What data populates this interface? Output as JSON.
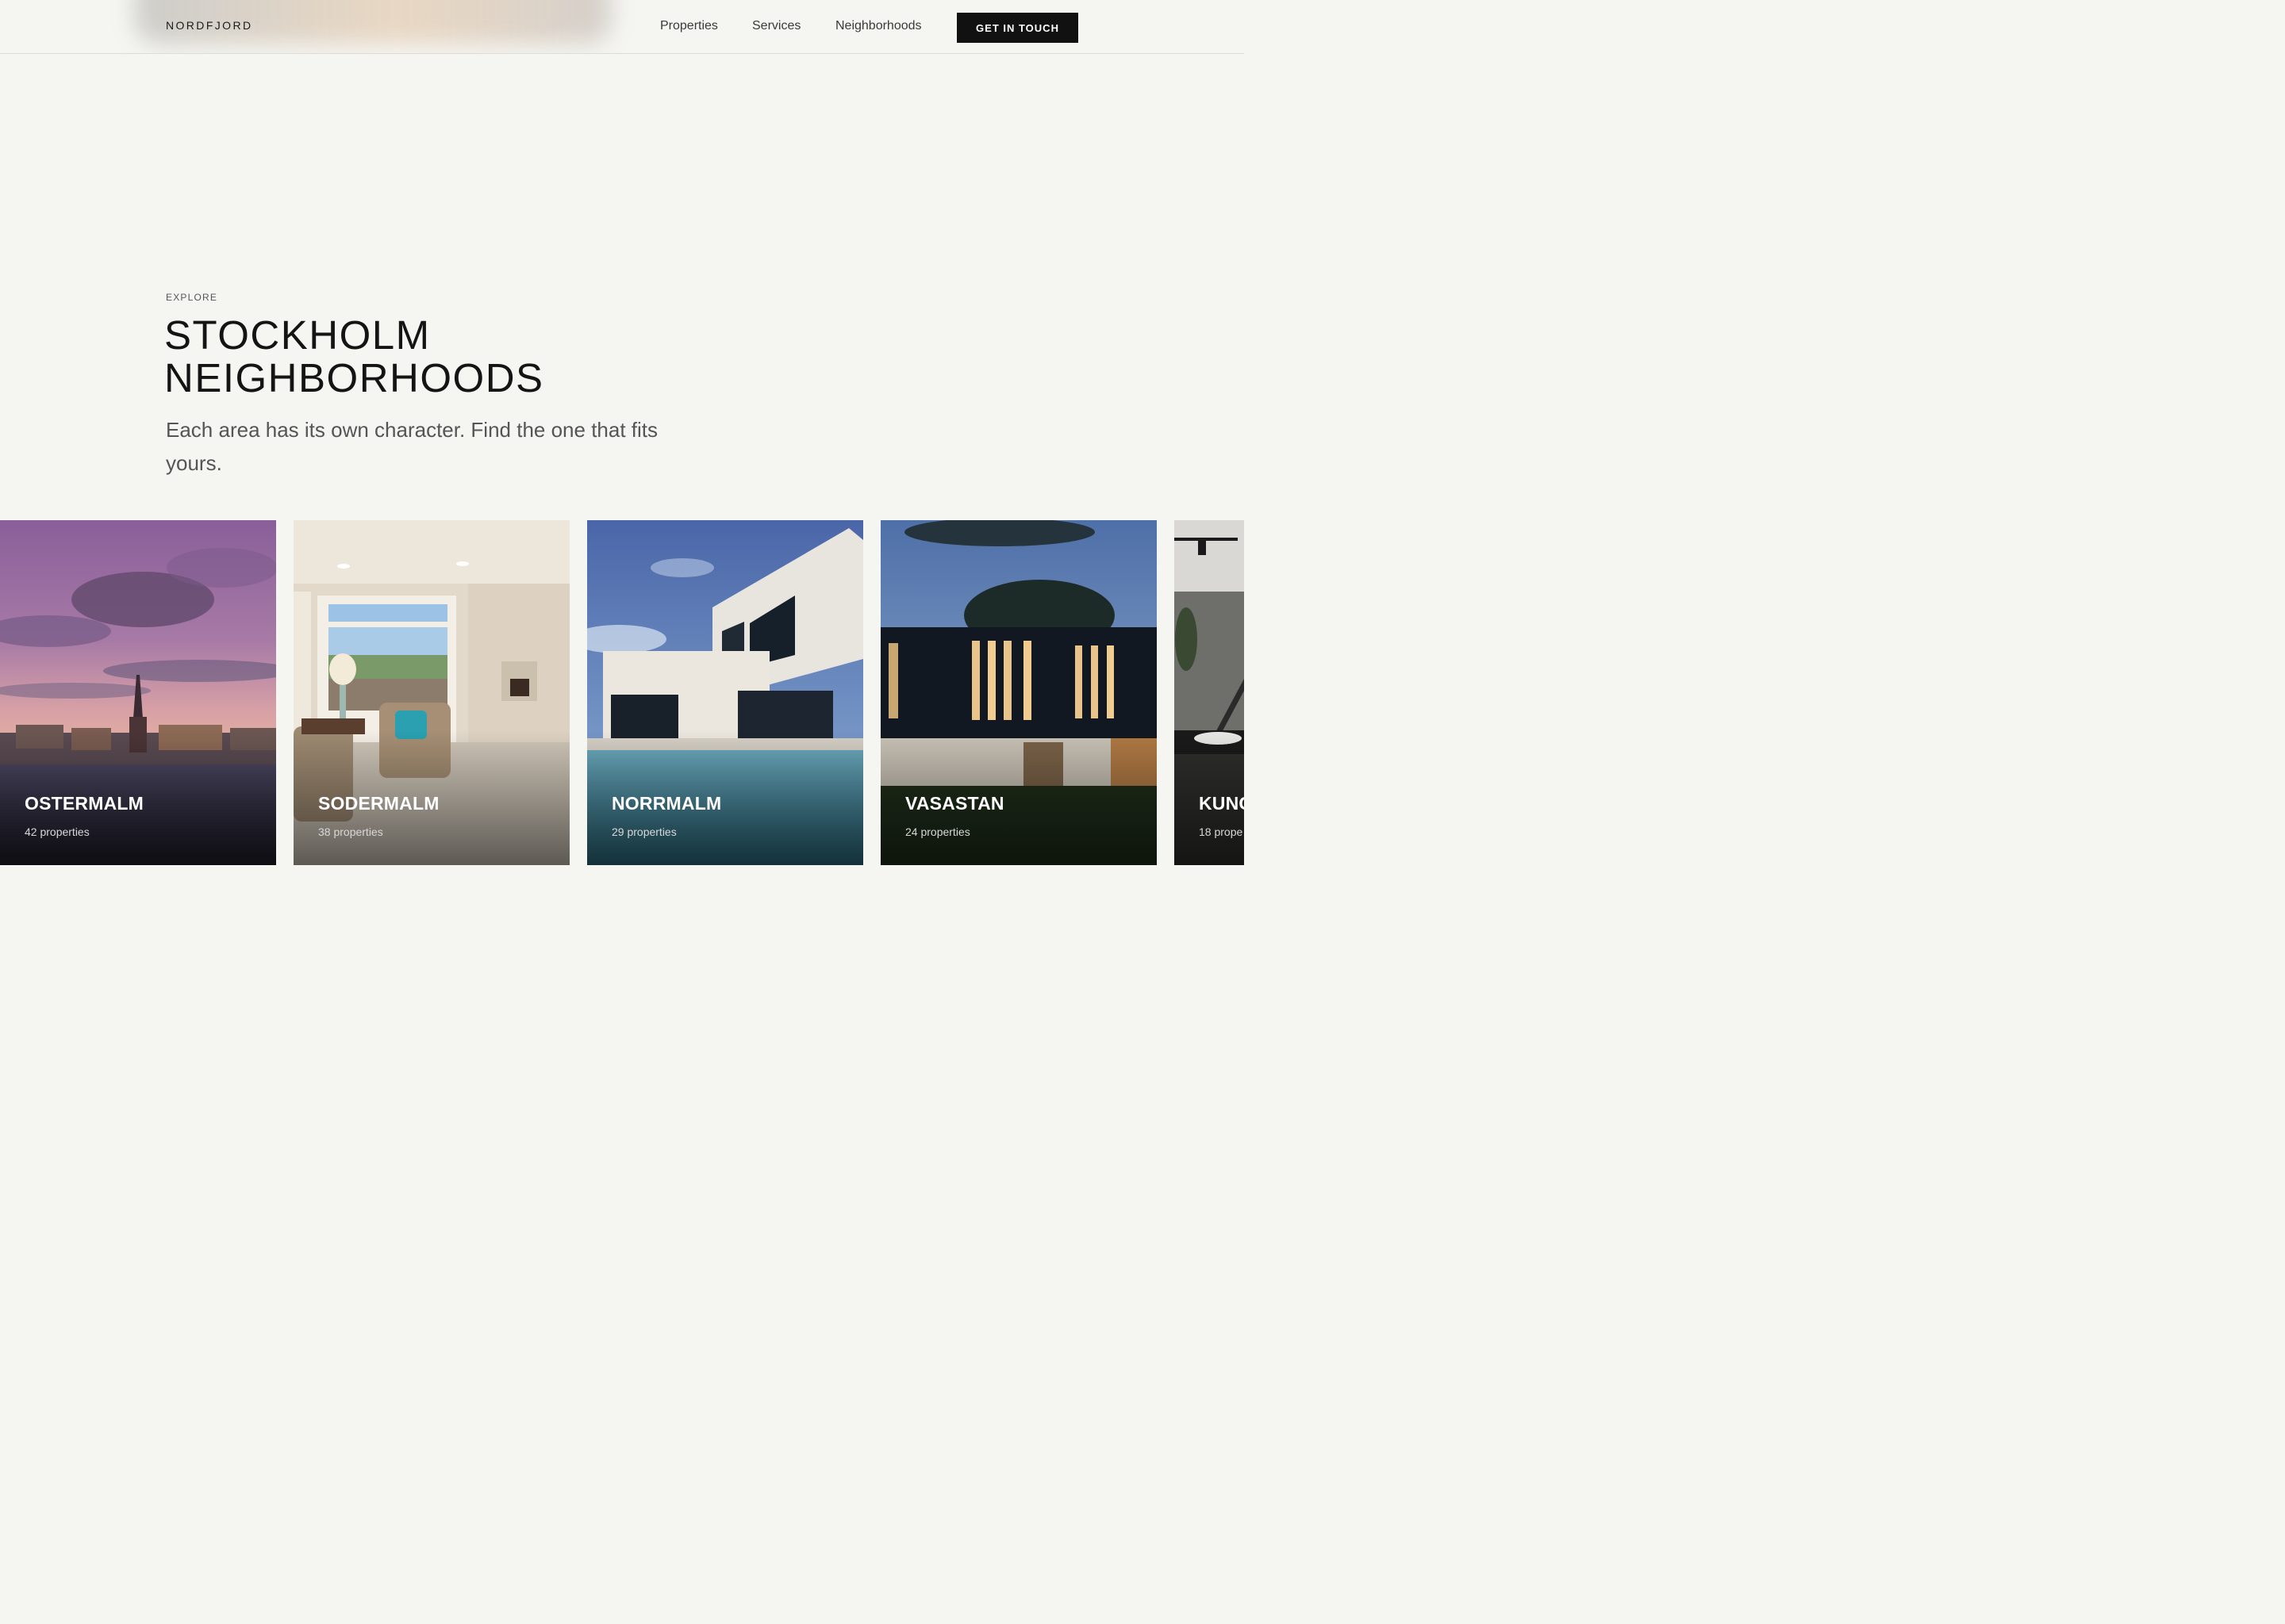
{
  "header": {
    "logo": "NORDFJORD",
    "nav": [
      "Properties",
      "Services",
      "Neighborhoods"
    ],
    "cta": "GET IN TOUCH"
  },
  "hero": {
    "eyebrow": "EXPLORE",
    "title_lines": [
      "STOCKHOLM",
      "NEIGHBORHOODS"
    ],
    "subtitle": "Each area has its own character. Find the one that fits yours."
  },
  "neighborhoods": [
    {
      "name": "OSTERMALM",
      "count": "42 properties",
      "image": "city-sunset-skyline-photo"
    },
    {
      "name": "SODERMALM",
      "count": "38 properties",
      "image": "living-room-interior-photo"
    },
    {
      "name": "NORRMALM",
      "count": "29 properties",
      "image": "modern-villa-pool-photo"
    },
    {
      "name": "VASASTAN",
      "count": "24 properties",
      "image": "dark-facade-house-dusk-photo"
    },
    {
      "name": "KUNG",
      "count": "18 prope",
      "image": "interior-staircase-photo"
    }
  ],
  "colors": {
    "background": "#f5f5f1",
    "cta_background": "#111111",
    "text": "#151515"
  }
}
